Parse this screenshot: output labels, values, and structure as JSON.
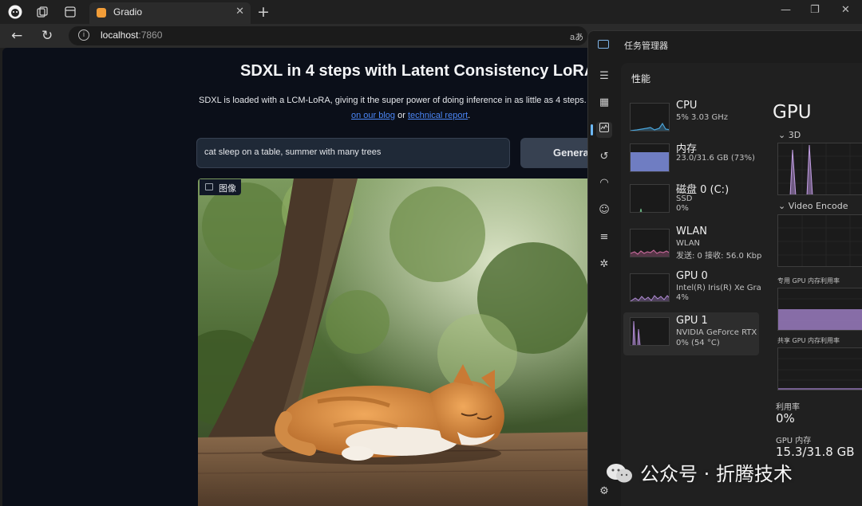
{
  "browser": {
    "tab_title": "Gradio",
    "url_host": "localhost",
    "url_port": ":7860",
    "reader_glyph": "aあ",
    "icons": [
      "profile-icon",
      "collections-icon",
      "tab-actions-icon",
      "gradio-favicon",
      "close-icon",
      "new-tab-icon",
      "minimize-icon",
      "restore-icon",
      "close-window-icon",
      "back-icon",
      "refresh-icon",
      "site-info-icon"
    ]
  },
  "gradio": {
    "title": "SDXL in 4 steps with Latent Consistency LoRAs",
    "description_line1": "SDXL is loaded with a LCM-LoRA, giving it the super power of doing inference in as little as 4 steps.",
    "description_link1": "L",
    "description_link2": "on our blog",
    "description_mid": " or ",
    "description_link3": "technical report",
    "description_end": ".",
    "prompt_value": "cat sleep on a table, summer with many trees",
    "generate_label": "Genera",
    "image_label": "图像"
  },
  "task_manager": {
    "title": "任务管理器",
    "heading": "性能",
    "items": [
      {
        "name": "CPU",
        "sub1": "5% 3.03 GHz",
        "sub2": "",
        "sub3": ""
      },
      {
        "name": "内存",
        "sub1": "23.0/31.6 GB (73%)",
        "sub2": "",
        "sub3": ""
      },
      {
        "name": "磁盘 0 (C:)",
        "sub1": "SSD",
        "sub2": "0%",
        "sub3": ""
      },
      {
        "name": "WLAN",
        "sub1": "WLAN",
        "sub2": "发送: 0 接收: 56.0 Kbp",
        "sub3": ""
      },
      {
        "name": "GPU 0",
        "sub1": "Intel(R) Iris(R) Xe Gra",
        "sub2": "4%",
        "sub3": ""
      },
      {
        "name": "GPU 1",
        "sub1": "NVIDIA GeForce RTX",
        "sub2": "0% (54 °C)",
        "sub3": ""
      }
    ],
    "detail": {
      "title": "GPU",
      "engine_3d": "3D",
      "engine_video": "Video Encode",
      "dedicated_label": "专用 GPU 内存利用率",
      "shared_label": "共享 GPU 内存利用率",
      "util_label": "利用率",
      "util_value": "0%",
      "mem_label": "GPU 内存",
      "mem_value": "15.3/31.8 GB"
    },
    "colors": {
      "cpu": "#4aa3d8",
      "memory": "#7f8fe0",
      "disk": "#6fbf8a",
      "wlan": "#c76b9c",
      "gpu": "#b28cd6"
    }
  },
  "watermark": {
    "text": "公众号 · 折腾技术"
  }
}
